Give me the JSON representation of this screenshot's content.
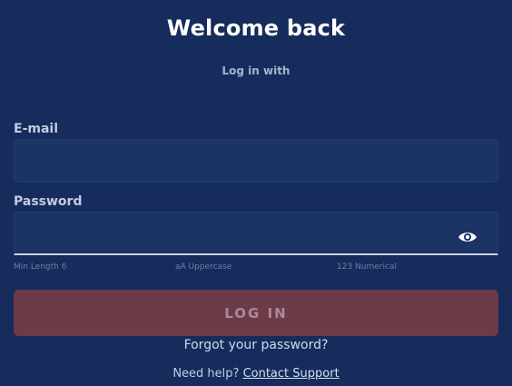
{
  "header": {
    "title": "Welcome back",
    "subtitle": "Log in with"
  },
  "form": {
    "email_label": "E-mail",
    "email_value": "",
    "password_label": "Password",
    "password_value": "",
    "password_toggle_icon": "eye-icon",
    "hints": [
      "Min Length 6",
      "aA Uppercase",
      "123 Numerical"
    ],
    "login_label": "LOG IN"
  },
  "footer": {
    "forgot_label": "Forgot your password?",
    "help_prefix": "Need help?",
    "support_link": "Contact Support"
  },
  "colors": {
    "background": "#152c5c",
    "input_bg": "#1c3464",
    "button_bg": "#6d3a48",
    "button_text": "#a98a99"
  }
}
